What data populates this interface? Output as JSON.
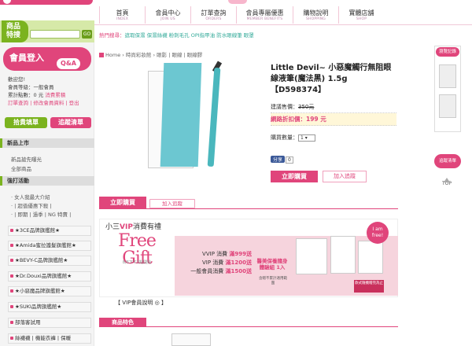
{
  "nav": [
    {
      "zh": "首頁",
      "en": "INDEX"
    },
    {
      "zh": "會員中心",
      "en": "JOIN US"
    },
    {
      "zh": "訂單查詢",
      "en": "ORDERS"
    },
    {
      "zh": "會員專屬優惠",
      "en": "MEMBER BENEFITS"
    },
    {
      "zh": "購物說明",
      "en": "SHOPPING"
    },
    {
      "zh": "實體店舖",
      "en": "SHOP"
    }
  ],
  "sidebar": {
    "special_tag_line1": "商品",
    "special_tag_line2": "特搜",
    "go_label": "GO",
    "member_title": "會員登入",
    "qa_label": "Q&A",
    "welcome": "歡迎您!",
    "member_level": "會員等級：一般會員",
    "member_points_prefix": "累計點數：0 元  ",
    "member_points_link": "消費累積",
    "member_links": "訂單查詢 | 修改會員資料 | 登出",
    "fill_btn": "拾貴填單",
    "track_btn": "追蹤清單",
    "new_head": "新品上市",
    "new_items": [
      "新品搶先曝光",
      "全部商品"
    ],
    "events_head": "強打活動",
    "event_items": [
      "· 女人我最大介紹",
      "· | 超值優惠下殺 |",
      "· | 即期 | 過季 | NG 特賣 |"
    ],
    "brands": [
      "★3CE品牌旗艦館★",
      "★Amida蜜拉護髮旗艦館★",
      "★BEVY-C品牌旗艦館★",
      "★Dr.Douxi品牌旗艦館★",
      "★小惡魔品牌旗艦館★",
      "★SUKI品牌旗艦館★",
      "部落客試用",
      "絲襪襪 | 機能衣褲 | 保暖"
    ]
  },
  "hot_search_label": "熱門搜尋：",
  "hot_search": "遮瑕保濕 保濕絲襪 粉刺毛孔 OPI指甲油 防水眼線筆 眼罩",
  "breadcrumb": "Home  ›  時尚彩妝館  ›  眼影  |  眼線  |  眼線膠",
  "product": {
    "title": "Little Devil~ 小惡魔觸行無阻眼線液筆(魔法黑) 1.5g【D598374】",
    "orig_label": "建議售價：",
    "orig_price": "350元",
    "sale_label": "網路折扣價：",
    "sale_price": "199 元",
    "qty_label": "購買數量：",
    "qty_value": "1",
    "share_label": "分享",
    "share_count": "0",
    "buy_label": "立即購買",
    "track_label": "加入追蹤"
  },
  "buy_bar": {
    "buy": "立即購買",
    "track": "加入追蹤"
  },
  "vip": {
    "title_prefix": "小三",
    "title_vip": "VIP",
    "title_suffix": "消費有禮",
    "free_gift": "Free Gift",
    "date_note": "8/6下午3點開始",
    "link": "【 VIP會員說明 ◎ 】",
    "tiers": [
      {
        "label": "VVIP 消費",
        "amount": "滿999送"
      },
      {
        "label": "VIP 消費",
        "amount": "滿1200送"
      },
      {
        "label": "一般會員消費",
        "amount": "滿1500送"
      }
    ],
    "gift_label": "醫美保養隨身體驗組 1入",
    "gift_note": "含贈不累計適用範圍",
    "i_am_free": "I am free!",
    "corner_tag": "款式隨機贈完為止"
  },
  "feature_tab": "商品特色",
  "rail": {
    "recent": "瀏覽記錄",
    "track": "追蹤清單",
    "top": "TOP"
  }
}
